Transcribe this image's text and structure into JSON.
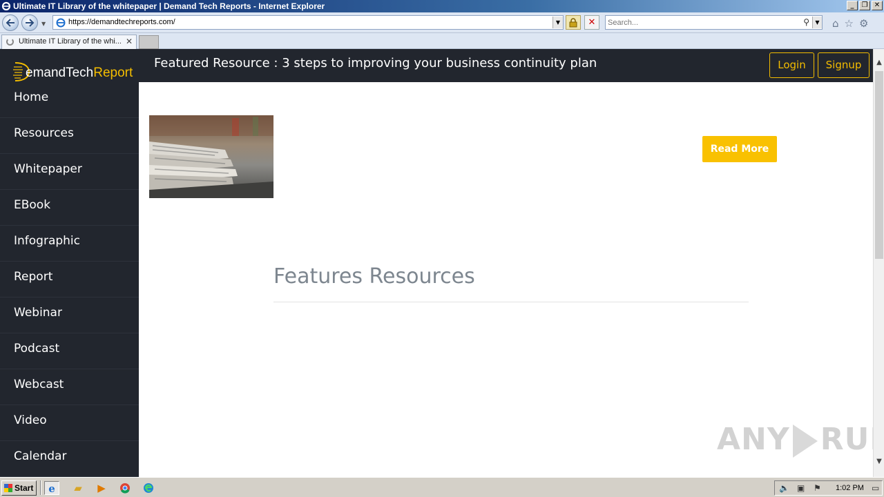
{
  "window": {
    "title": "Ultimate IT Library of the whitepaper | Demand Tech Reports - Internet Explorer",
    "controls": {
      "minimize": "_",
      "maximize": "❐",
      "close": "✕"
    }
  },
  "browser": {
    "url": "https://demandtechreports.com/",
    "search_placeholder": "Search...",
    "tab_title": "Ultimate IT Library of the whi...",
    "tab_close": "✕"
  },
  "site": {
    "logo_prefix": "emandTech",
    "logo_accent": "Report",
    "featured_text": "Featured Resource : 3 steps to improving your business continuity plan",
    "login_label": "Login",
    "signup_label": "Signup",
    "nav": [
      {
        "label": "Home"
      },
      {
        "label": "Resources"
      },
      {
        "label": "Whitepaper"
      },
      {
        "label": "EBook"
      },
      {
        "label": "Infographic"
      },
      {
        "label": "Report"
      },
      {
        "label": "Webinar"
      },
      {
        "label": "Podcast"
      },
      {
        "label": "Webcast"
      },
      {
        "label": "Video"
      },
      {
        "label": "Calendar"
      }
    ],
    "read_more_label": "Read More",
    "section_title": "Features Resources",
    "colors": {
      "dark": "#22262e",
      "accent": "#f4bd00",
      "button": "#f9c101"
    }
  },
  "watermark": {
    "left": "ANY",
    "right": "RUN"
  },
  "taskbar": {
    "start_label": "Start",
    "clock": "1:02 PM"
  }
}
